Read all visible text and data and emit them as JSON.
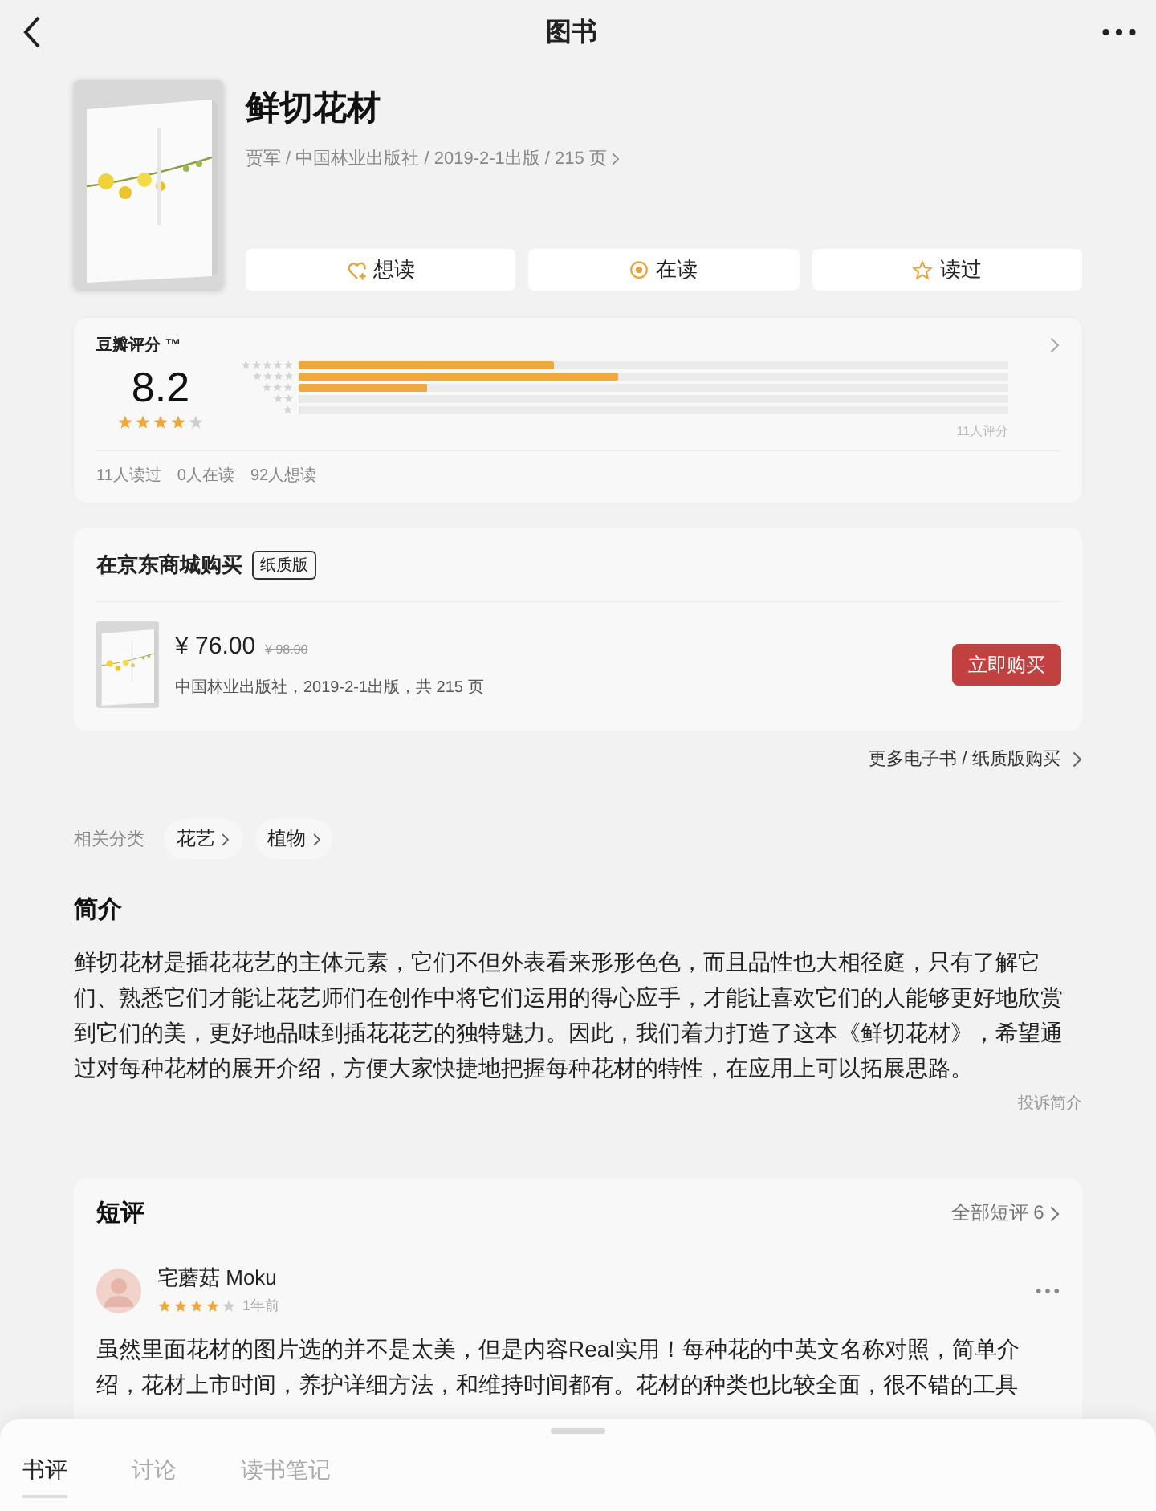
{
  "nav": {
    "title": "图书"
  },
  "book": {
    "title": "鲜切花材",
    "meta": "贾军 / 中国林业出版社 / 2019-2-1出版 / 215 页",
    "actions": [
      {
        "label": "想读",
        "kind": "want"
      },
      {
        "label": "在读",
        "kind": "reading"
      },
      {
        "label": "读过",
        "kind": "read"
      }
    ]
  },
  "rating": {
    "title": "豆瓣评分 ™",
    "score": "8.2",
    "stars": 4,
    "distribution": [
      {
        "level": 0.36
      },
      {
        "level": 0.45
      },
      {
        "level": 0.18
      },
      {
        "level": 0
      },
      {
        "level": 0
      }
    ],
    "count": "11人评分",
    "stats": [
      "11人读过",
      "0人在读",
      "92人想读"
    ]
  },
  "buy": {
    "title": "在京东商城购买",
    "tag": "纸质版",
    "price": "¥ 76.00",
    "original_price": "¥ 98.00",
    "info": "中国林业出版社，2019-2-1出版，共 215 页",
    "button": "立即购买"
  },
  "more_link": "更多电子书 / 纸质版购买",
  "categories": {
    "label": "相关分类",
    "tags": [
      "花艺",
      "植物"
    ]
  },
  "intro": {
    "heading": "简介",
    "text": "鲜切花材是插花花艺的主体元素，它们不但外表看来形形色色，而且品性也大相径庭，只有了解它们、熟悉它们才能让花艺师们在创作中将它们运用的得心应手，才能让喜欢它们的人能够更好地欣赏到它们的美，更好地品味到插花花艺的独特魅力。因此，我们着力打造了这本《鲜切花材》，希望通过对每种花材的展开介绍，方便大家快捷地把握每种花材的特性，在应用上可以拓展思路。",
    "report": "投诉简介"
  },
  "reviews": {
    "heading": "短评",
    "all_link": "全部短评 6",
    "items": [
      {
        "author": "宅蘑菇 Moku",
        "stars": 4,
        "time": "1年前",
        "text": "虽然里面花材的图片选的并不是太美，但是内容Real实用！每种花的中英文名称对照，简单介绍，花材上市时间，养护详细方法，和维持时间都有。花材的种类也比较全面，很不错的工具"
      }
    ]
  },
  "bottom_tabs": [
    {
      "label": "书评",
      "selected": true
    },
    {
      "label": "讨论",
      "selected": false
    },
    {
      "label": "读书笔记",
      "selected": false
    }
  ]
}
